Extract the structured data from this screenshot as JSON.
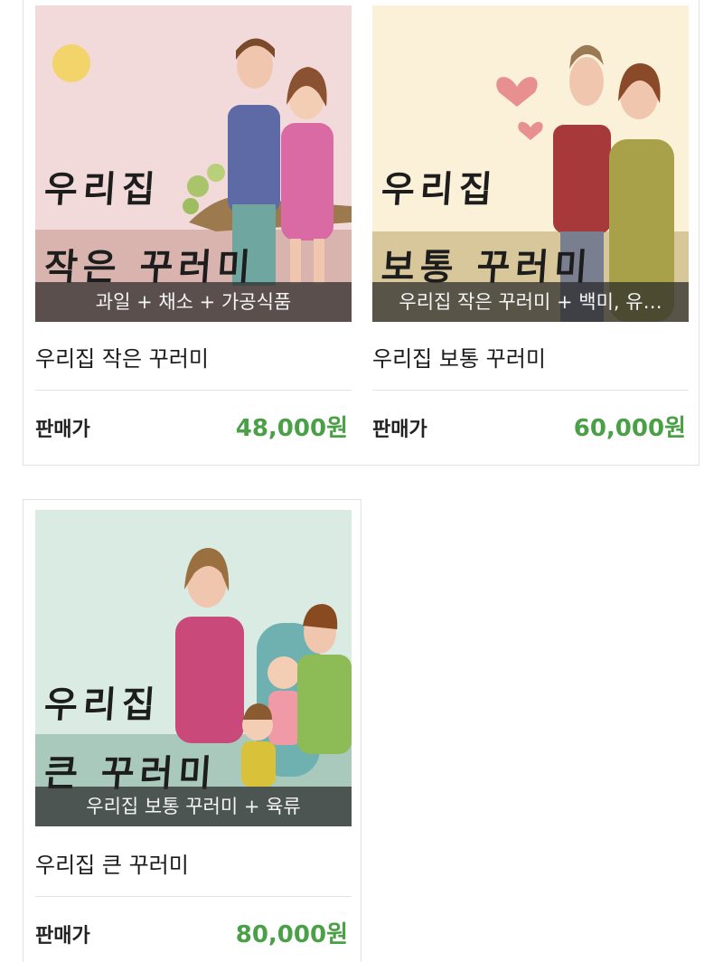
{
  "colors": {
    "price": "#4aa046",
    "caption_bg": "rgba(40,40,40,0.72)",
    "border": "#e2e2e2"
  },
  "products": [
    {
      "image_title_line1": "우리집",
      "image_title_line2": "작은 꾸러미",
      "caption": "과일 + 채소 + 가공식품",
      "name": "우리집 작은 꾸러미",
      "price_label": "판매가",
      "price": "48,000원",
      "illustration": "couple-with-sun-illustration",
      "bg_color": "#f3dada"
    },
    {
      "image_title_line1": "우리집",
      "image_title_line2": "보통 꾸러미",
      "caption": "우리집 작은 꾸러미 + 백미, 유…",
      "name": "우리집 보통 꾸러미",
      "price_label": "판매가",
      "price": "60,000원",
      "illustration": "couple-with-hearts-illustration",
      "bg_color": "#fbf1d8"
    },
    {
      "image_title_line1": "우리집",
      "image_title_line2": "큰 꾸러미",
      "caption": "우리집 보통 꾸러미 + 육류",
      "name": "우리집 큰 꾸러미",
      "price_label": "판매가",
      "price": "80,000원",
      "illustration": "family-illustration",
      "bg_color": "#d9ebe3"
    }
  ]
}
